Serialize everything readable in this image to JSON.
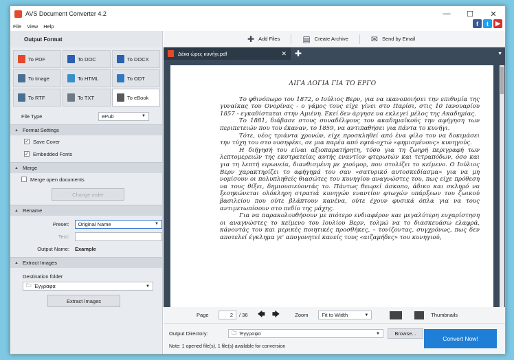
{
  "window": {
    "title": "AVS Document Converter 4.2"
  },
  "menu": {
    "file": "File",
    "view": "View",
    "help": "Help"
  },
  "social": {
    "facebook": "f",
    "twitter": "t",
    "youtube": "▶"
  },
  "output_format": {
    "title": "Output Format",
    "formats": [
      {
        "label": "To PDF",
        "color": "#e24a2b"
      },
      {
        "label": "To DOC",
        "color": "#2b5fb0"
      },
      {
        "label": "To DOCX",
        "color": "#2b5fb0"
      },
      {
        "label": "To Image",
        "color": "#4a6f91"
      },
      {
        "label": "To HTML",
        "color": "#3a8fc8"
      },
      {
        "label": "To ODT",
        "color": "#2f79c2"
      },
      {
        "label": "To RTF",
        "color": "#4a6f91"
      },
      {
        "label": "To TXT",
        "color": "#6d7a86"
      },
      {
        "label": "To eBook",
        "color": "#5a5a5a"
      }
    ],
    "file_type_label": "File Type",
    "file_type_value": "ePub"
  },
  "format_settings": {
    "title": "Format Settings",
    "save_cover": "Save Cover",
    "embedded_fonts": "Embedded Fonts"
  },
  "merge": {
    "title": "Merge",
    "merge_open": "Merge open documents",
    "change_order": "Change order"
  },
  "rename": {
    "title": "Rename",
    "preset_label": "Preset:",
    "preset_value": "Original Name",
    "text_label": "Text:",
    "output_name_label": "Output Name:",
    "output_name_value": "Example"
  },
  "extract": {
    "title": "Extract Images",
    "dest_label": "Destination folder",
    "dest_value": "Έγγραφα",
    "button": "Extract Images"
  },
  "toolbar": {
    "add_files": "Add Files",
    "create_archive": "Create Archive",
    "send_email": "Send by Email"
  },
  "tab": {
    "name": "Δέκα ώρες κυνήγι.pdf"
  },
  "document": {
    "heading": "ΛΙΓΑ ΛΟΓΙΑ ΓΙΑ ΤΟ ΕΡΓΟ",
    "paragraphs": [
      "Το φθινόπωρο του 1872, ο Ιούλιος Βερν, για να ικανοποιήσει την επιθυμία της γυναίκας του Ονορίνας - ο γάμος τους είχε γίνει στο Παρίσι, στις 10 Ιανουαρίου 1857 - εγκαθίσταται στην Αμιένη. Εκεί δεν άργησε να εκλεγεί μέλος της Ακαδημίας.",
      "Το 1881, διάβασε στους συναδέλφους του ακαδημαϊκούς την αφήγηση των περιπετειών που του έκαναν, το 1859, να αντιπαθήσει για πάντα το κυνήγι.",
      "Τότε, νέος τριάντα χρονών, είχε προσκληθεί από ένα φίλο του να δοκιμάσει την τύχη του στο νυσηφέκι, σε μια παρέα από εφτά-οχτώ «φημισμένους» κυνηγούς.",
      "Η διήγησή του είναι αξιοπαρατήρητη, τόσο για τη ζωηρή περιγραφή των λεπτομερειών της εκστρατείας αυτής εναντίον φτερωτών και τετραπόδων, όσο και για τη λεπτή ειρωνεία, διανθισμένη με χιούμορ, που στολίζει το κείμενο. Ο Ιούλιος Βερν χαρακτηρίζει το αφήγημά του σαν «σατυρικό αυτοσκεδίασμα» για να μη νομίσουν οι πολυπληθείς θιασώτες του κυνηγίου αναγνώστες του, πως είχε πρόθεση να τους θίξει, δημιουσιεύοντάς το. Πάντως θεωρεί άσκοπο, άδικο και σκληρό να ξεσηκώνεται ολόκληρη στρατιά κυνηγών εναντίον φτωχών υπάρξεων του ζωικού βασιλείου που ούτε βλάπτουν κανένα, ούτε έχουν φυσικά όπλα για να τους αντιμετωπίσουν στο πεδίο της μάχης.",
      "Για να παρακολουθήσουν με πιότερο ενδιαφέρον και μεγαλύτερη ευχαρίστηση οι αναγνώστες το κείμενο του Ιουλίου Βερν, τολμώ να το διασκευάσω ελαφρά, κάνοντάς του και μερικές ποιητικές προσθήκες, – τονίζοντας, συγχρόνως, πως δεν αποτελεί έγκλημα γι' απογονητεί κανείς τους «αιζαμήδες» του κυνηγιού,"
    ]
  },
  "nav": {
    "page_label": "Page",
    "page_value": "2",
    "page_total": "/ 36",
    "zoom_label": "Zoom",
    "zoom_value": "Fit to Width",
    "thumbnails": "Thumbnails"
  },
  "output": {
    "dir_label": "Output Directory:",
    "dir_value": "Έγγραφα",
    "browse": "Browse...",
    "note": "Note: 1 opened file(s), 1 file(s) available for conversion",
    "convert": "Convert Now!"
  }
}
